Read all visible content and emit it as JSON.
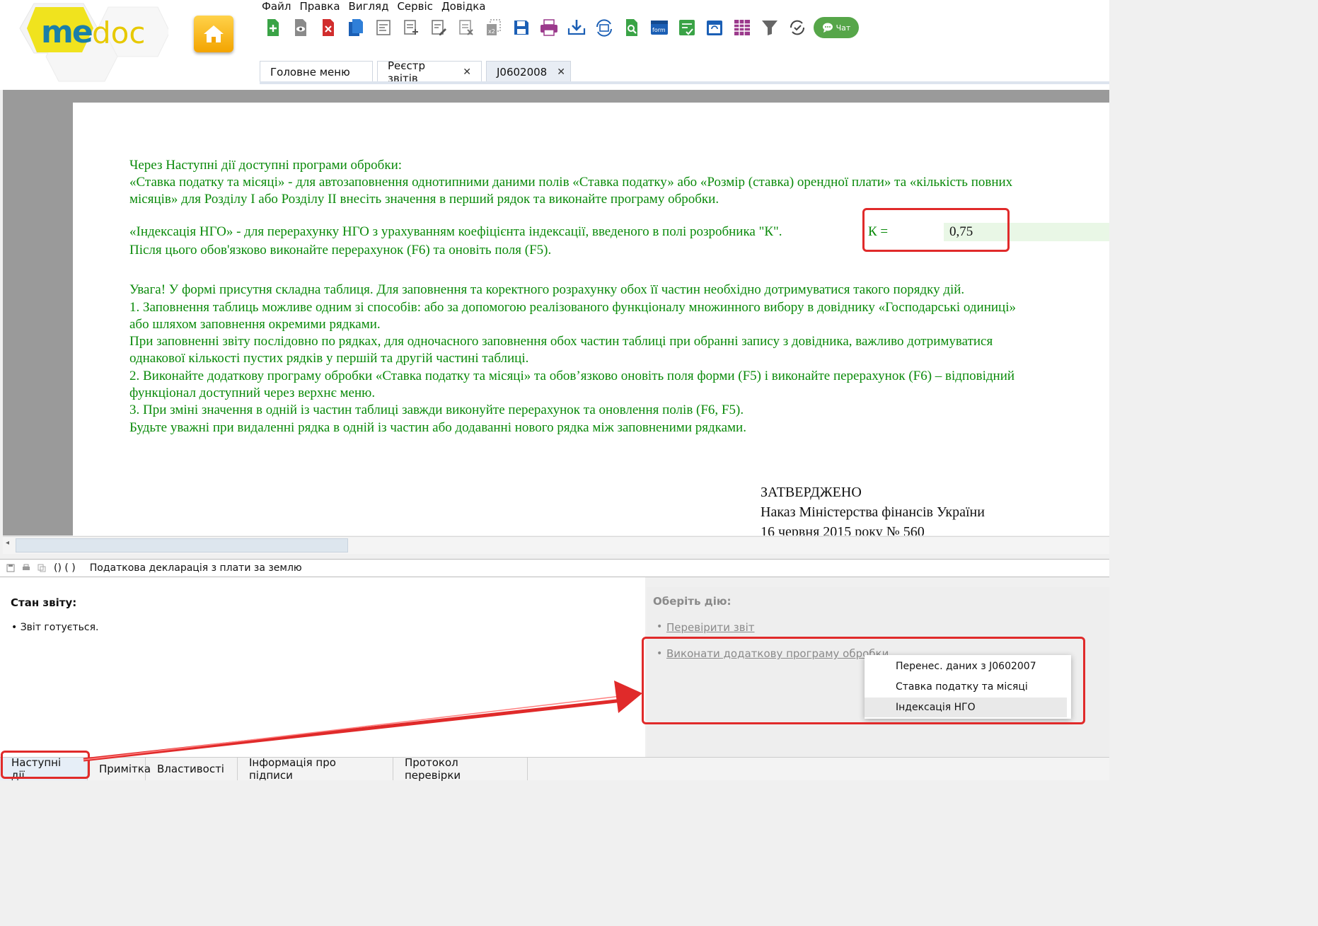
{
  "menu": [
    "Файл",
    "Правка",
    "Вигляд",
    "Сервіс",
    "Довідка"
  ],
  "logo": {
    "text_left": "me",
    "text_right": "doc"
  },
  "toolbar": {
    "icons": [
      "add-document-icon",
      "preview-icon",
      "delete-icon",
      "copy-icon",
      "edit-form-icon",
      "new-form-icon",
      "edit-icon",
      "clear-icon",
      "duplicate-x2-icon",
      "save-icon",
      "print-icon",
      "download-icon",
      "sync-icon",
      "search-document-icon",
      "form-icon",
      "checklist-icon",
      "calendar-icon",
      "table-icon",
      "filter-icon",
      "refresh-check-icon"
    ],
    "chat_label": "Чат"
  },
  "tabs": [
    {
      "label": "Головне меню",
      "closable": false
    },
    {
      "label": "Реєстр звітів",
      "closable": true
    },
    {
      "label": "J0602008",
      "closable": true,
      "active": true
    }
  ],
  "document": {
    "line1": "Через  Наступні дії доступні програми обробки:",
    "line2": "«Ставка податку та місяці» - для автозаповнення однотипними даними полів «Ставка податку» або «Розмір (ставка) орендної плати» та «кількість повних",
    "line3": "місяців» для Розділу І або Розділу ІІ внесіть значення в перший рядок та виконайте програму обробки.",
    "line4": "«Індексація НГО» - для перерахунку НГО з урахуванням коефіцієнта індексації, введеного в полі розробника \"К\".",
    "k_label": "К =",
    "k_value": "0,75",
    "line5": "Після цього обов'язково виконайте перерахунок (F6) та оновіть поля (F5).",
    "line6": "Увага! У формі присутня складна таблиця. Для заповнення та коректного розрахунку обох її частин  необхідно дотримуватися такого порядку дій.",
    "line7": "1. Заповнення таблиць можливе одним зі способів: або за допомогою реалізованого  функціоналу множинного вибору в довіднику  «Господарські одиниці»",
    "line8": "або шляхом заповнення окремими рядками.",
    "line9": "При  заповненні звіту послідовно по рядках, для одночасного заповнення обох частин таблиці при обранні запису з довідника, важливо дотримуватися",
    "line10": "однакової кількості пустих рядків у першій та другій  частині таблиці.",
    "line11": "2. Виконайте додаткову програму обробки «Ставка податку та місяці» та обов’язково оновіть поля форми (F5) і виконайте  перерахунок  (F6) – відповідний",
    "line12": "функціонал доступний через верхнє меню.",
    "line13": "3. При зміні значення в одній із частин таблиці завжди виконуйте перерахунок та оновлення полів (F6, F5).",
    "line14": "Будьте  уважні при  видаленні рядка в одній із частин або додаванні нового рядка між заповненими рядками.",
    "approved": "ЗАТВЕРДЖЕНО",
    "order": "Наказ Міністерства фінансів України",
    "date": "16 червня 2015 року № 560"
  },
  "statusbar": {
    "brackets": "() (  )",
    "title": "Податкова декларація з плати за землю"
  },
  "report_state": {
    "heading": "Стан звіту:",
    "item": "• Звіт готується."
  },
  "actions": {
    "heading": "Оберіть дію:",
    "check": "Перевірити звіт",
    "run_extra": "Виконати додаткову програму обробки",
    "menu": [
      "Перенес. даних з J0602007",
      "Ставка податку та місяці",
      "Індексація НГО"
    ]
  },
  "bottom_tabs": [
    "Наступні дії",
    "Примітка",
    "Властивості",
    "Інформація про підписи",
    "Протокол перевірки"
  ],
  "colors": {
    "doc_text": "#0a8a0a",
    "highlight": "#e02a2a",
    "chat": "#56a649"
  }
}
